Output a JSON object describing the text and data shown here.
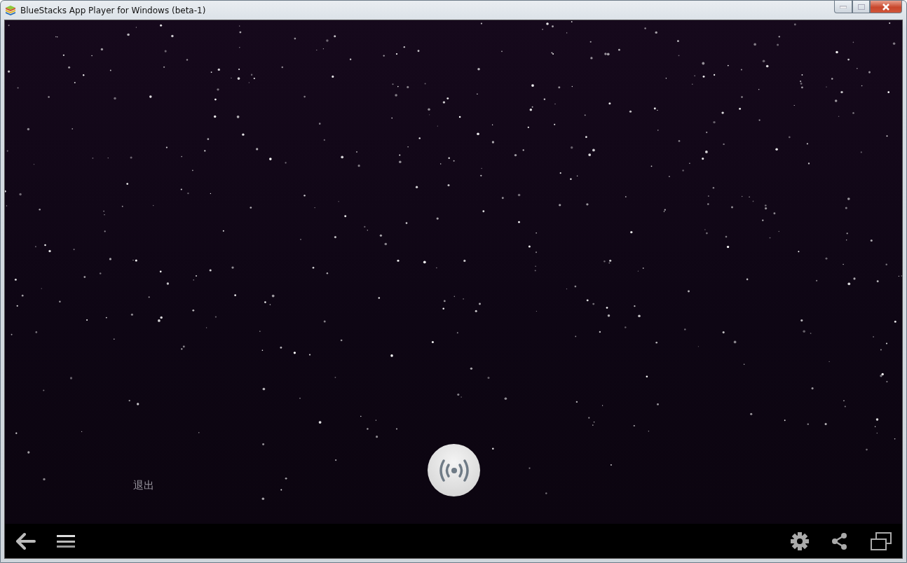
{
  "window": {
    "title": "BlueStacks App Player for Windows (beta-1)"
  },
  "screen": {
    "exit_label": "退出"
  }
}
